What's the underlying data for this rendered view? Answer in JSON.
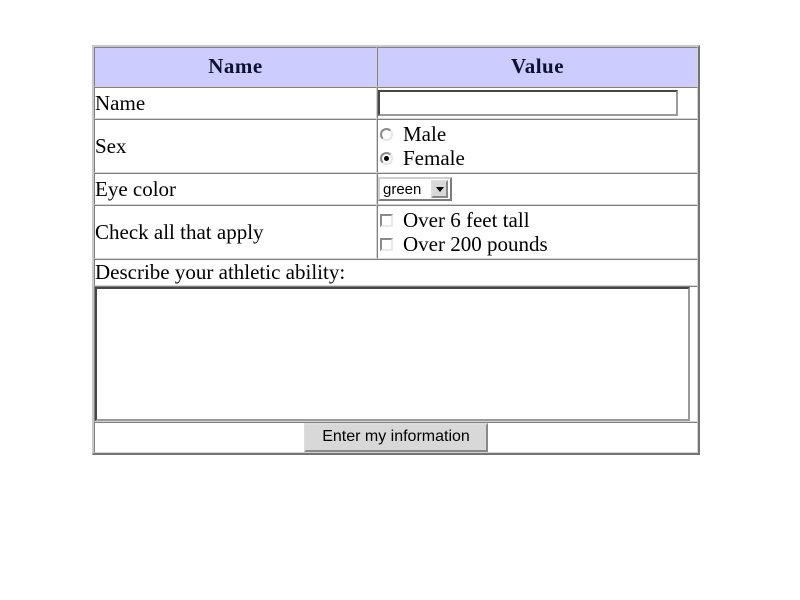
{
  "table": {
    "headers": {
      "name_column": "Name",
      "value_column": "Value"
    },
    "rows": [
      {
        "label": "Name",
        "control": "text-input",
        "value": "",
        "placeholder": ""
      },
      {
        "label": "Sex",
        "control": "radio-group",
        "options": [
          {
            "label": "Male",
            "checked": false
          },
          {
            "label": "Female",
            "checked": true
          }
        ]
      },
      {
        "label": "Eye color",
        "control": "select",
        "selected": "green"
      },
      {
        "label": "Check all that apply",
        "control": "checkbox-group",
        "options": [
          {
            "label": "Over 6 feet tall",
            "checked": false
          },
          {
            "label": "Over 200 pounds",
            "checked": false
          }
        ]
      }
    ],
    "textarea_row": {
      "label": "Describe your athletic ability:",
      "value": "",
      "placeholder": ""
    },
    "submit_row": {
      "button_label": "Enter my information"
    }
  },
  "colors": {
    "header_background": "#ccccff",
    "header_text": "#101030",
    "page_background": "#ffffff",
    "table_border": "#c8c8c8",
    "cell_border": "#d4d4d4",
    "control_face": "#d8d8d8",
    "control_border_dark": "#8b8b8b",
    "body_text": "#000000"
  },
  "icons": {
    "dropdown_arrow": "chevron-down-icon",
    "radio_selected": "radio-checked-icon",
    "radio_unselected": "radio-unchecked-icon",
    "checkbox_unchecked": "checkbox-unchecked-icon"
  }
}
